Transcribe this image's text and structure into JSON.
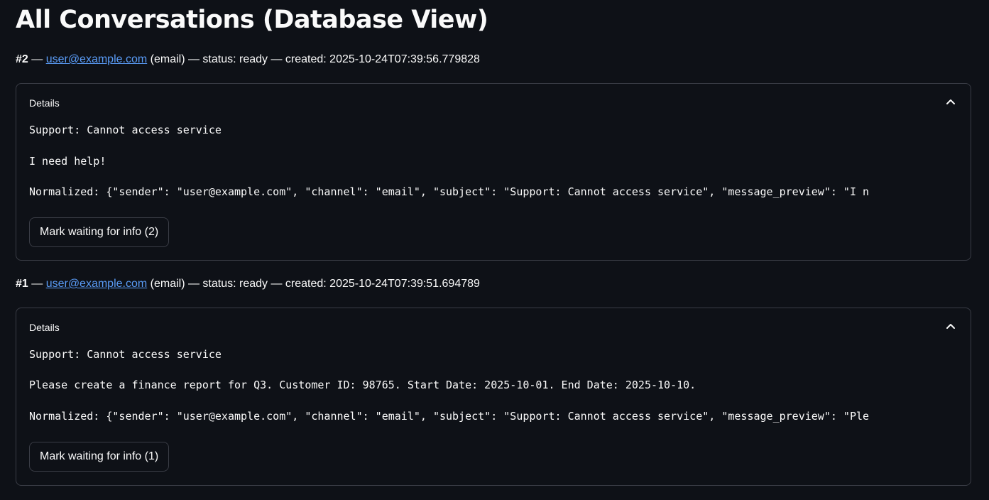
{
  "page": {
    "title": "All Conversations (Database View)"
  },
  "conversations": [
    {
      "number": "#2",
      "sep1": " — ",
      "sender": "user@example.com",
      "channel_text": " (email) — status: ready — created: 2025-10-24T07:39:56.779828",
      "expander_label": "Details",
      "subject": "Support: Cannot access service",
      "message": "I need help!",
      "normalized": "Normalized: {\"sender\": \"user@example.com\", \"channel\": \"email\", \"subject\": \"Support: Cannot access service\", \"message_preview\": \"I n",
      "button_label": "Mark waiting for info (2)"
    },
    {
      "number": "#1",
      "sep1": " — ",
      "sender": "user@example.com",
      "channel_text": " (email) — status: ready — created: 2025-10-24T07:39:51.694789",
      "expander_label": "Details",
      "subject": "Support: Cannot access service",
      "message": "Please create a finance report for Q3. Customer ID: 98765. Start Date: 2025-10-01. End Date: 2025-10-10.",
      "normalized": "Normalized: {\"sender\": \"user@example.com\", \"channel\": \"email\", \"subject\": \"Support: Cannot access service\", \"message_preview\": \"Ple",
      "button_label": "Mark waiting for info (1)"
    }
  ],
  "icons": {
    "expander_toggle": "chevron-up-icon"
  },
  "colors": {
    "background": "#0e1117",
    "text": "#fafafa",
    "link": "#5a9cf7",
    "border": "#3a3d46"
  }
}
